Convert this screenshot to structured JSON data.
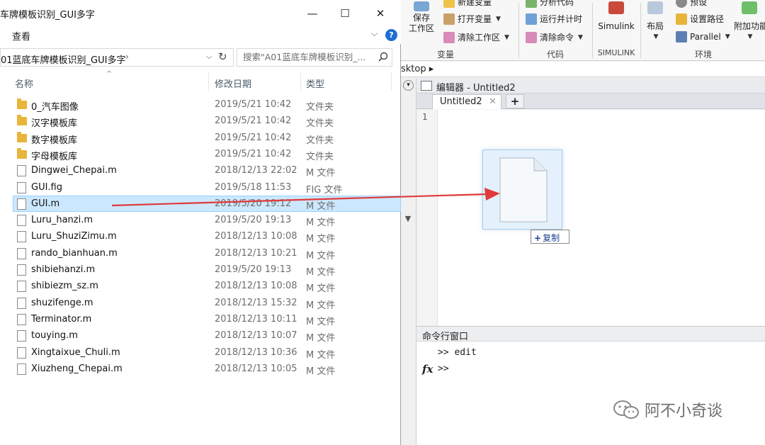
{
  "explorer": {
    "title": "车牌模板识别_GUI多字",
    "ribbon_tab": "查看",
    "address": "01蓝底车牌模板识别_GUI多字",
    "search_placeholder": "搜索\"A01蓝底车牌模板识别_...",
    "columns": {
      "name": "名称",
      "date": "修改日期",
      "type": "类型"
    },
    "files": [
      {
        "name": "0_汽车图像",
        "date": "2019/5/21 10:42",
        "type": "文件夹",
        "kind": "folder"
      },
      {
        "name": "汉字模板库",
        "date": "2019/5/21 10:42",
        "type": "文件夹",
        "kind": "folder"
      },
      {
        "name": "数字模板库",
        "date": "2019/5/21 10:42",
        "type": "文件夹",
        "kind": "folder"
      },
      {
        "name": "字母模板库",
        "date": "2019/5/21 10:42",
        "type": "文件夹",
        "kind": "folder"
      },
      {
        "name": "Dingwei_Chepai.m",
        "date": "2018/12/13 22:02",
        "type": "M 文件",
        "kind": "file"
      },
      {
        "name": "GUI.fig",
        "date": "2019/5/18 11:53",
        "type": "FIG 文件",
        "kind": "file"
      },
      {
        "name": "GUI.m",
        "date": "2019/5/20 19:12",
        "type": "M 文件",
        "kind": "file",
        "selected": true
      },
      {
        "name": "Luru_hanzi.m",
        "date": "2019/5/20 19:13",
        "type": "M 文件",
        "kind": "file"
      },
      {
        "name": "Luru_ShuziZimu.m",
        "date": "2018/12/13 10:08",
        "type": "M 文件",
        "kind": "file"
      },
      {
        "name": "rando_bianhuan.m",
        "date": "2018/12/13 10:21",
        "type": "M 文件",
        "kind": "file"
      },
      {
        "name": "shibiehanzi.m",
        "date": "2019/5/20 19:13",
        "type": "M 文件",
        "kind": "file"
      },
      {
        "name": "shibiezm_sz.m",
        "date": "2018/12/13 10:08",
        "type": "M 文件",
        "kind": "file"
      },
      {
        "name": "shuzifenge.m",
        "date": "2018/12/13 15:32",
        "type": "M 文件",
        "kind": "file"
      },
      {
        "name": "Terminator.m",
        "date": "2018/12/13 10:11",
        "type": "M 文件",
        "kind": "file"
      },
      {
        "name": "touying.m",
        "date": "2018/12/13 10:07",
        "type": "M 文件",
        "kind": "file"
      },
      {
        "name": "Xingtaixue_Chuli.m",
        "date": "2018/12/13 10:36",
        "type": "M 文件",
        "kind": "file"
      },
      {
        "name": "Xiuzheng_Chepai.m",
        "date": "2018/12/13 10:05",
        "type": "M 文件",
        "kind": "file"
      }
    ]
  },
  "matlab": {
    "toolstrip": {
      "save_workspace": "保存\n工作区",
      "new_variable": "新建变量",
      "open_variable": "打开变量",
      "clear_workspace": "清除工作区",
      "analyze_code": "分析代码",
      "run_and_time": "运行并计时",
      "clear_commands": "清除命令",
      "simulink": "Simulink",
      "layout": "布局",
      "preferences": "预设",
      "set_path": "设置路径",
      "parallel": "Parallel",
      "addons": "附加功能",
      "group_variable": "变量",
      "group_code": "代码",
      "group_simulink": "SIMULINK",
      "group_environment": "环境"
    },
    "path": "sktop ▸",
    "editor_title": "编辑器 - Untitled2",
    "tab_label": "Untitled2",
    "line_number": "1",
    "cmd_title": "命令行窗口",
    "cmd_history": ">> edit",
    "cmd_prompt": ">>"
  },
  "drag": {
    "copy_label": "复制"
  },
  "watermark": {
    "text": "阿不小奇谈"
  },
  "colors": {
    "selection": "#cce8ff",
    "arrow": "#e03a3a",
    "folder": "#e8b43a",
    "help": "#1d6fd1"
  }
}
